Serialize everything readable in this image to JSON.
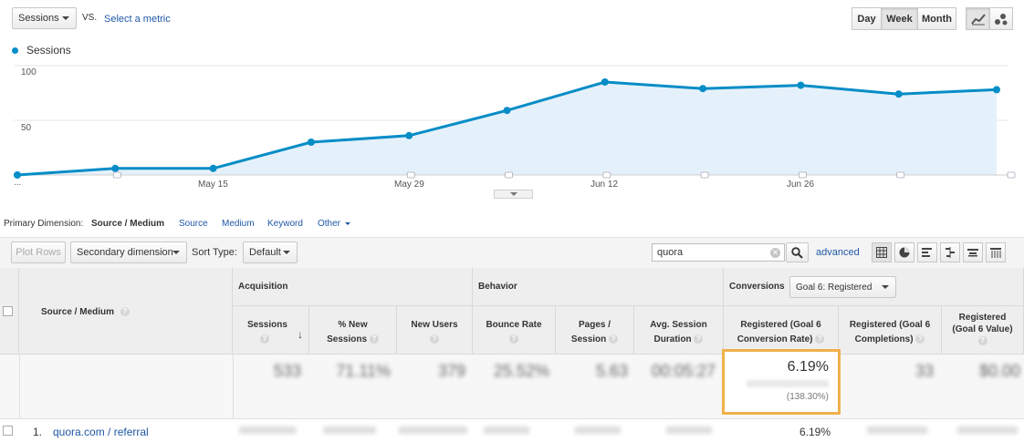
{
  "top": {
    "metric_select": "Sessions",
    "vs_label": "VS.",
    "select_metric_link": "Select a metric",
    "range_tabs": [
      "Day",
      "Week",
      "Month"
    ],
    "active_tab": "Week"
  },
  "chart_data": {
    "type": "area",
    "series": [
      {
        "name": "Sessions",
        "values": [
          0,
          6,
          6,
          30,
          36,
          59,
          85,
          79,
          82,
          74,
          78
        ]
      }
    ],
    "x_tick_labels": [
      "...",
      "May 15",
      "May 29",
      "Jun 12",
      "Jun 26"
    ],
    "y_tick_labels": [
      "100",
      "50"
    ],
    "ylim": [
      0,
      100
    ],
    "color": "#058dc7",
    "fill": "#e5f1fa",
    "grid": true
  },
  "dimension_bar": {
    "label": "Primary Dimension:",
    "active": "Source / Medium",
    "options": [
      "Source",
      "Medium",
      "Keyword",
      "Other"
    ]
  },
  "toolbar": {
    "plot_rows": "Plot Rows",
    "secondary_dimension": "Secondary dimension",
    "sort_type_label": "Sort Type:",
    "sort_default": "Default",
    "search_value": "quora",
    "advanced": "advanced"
  },
  "table": {
    "source_medium_header": "Source / Medium",
    "groups": {
      "acquisition": "Acquisition",
      "behavior": "Behavior",
      "conversions": "Conversions",
      "goal_select": "Goal 6: Registered"
    },
    "columns": {
      "sessions": "Sessions",
      "pct_new_1": "% New",
      "pct_new_2": "Sessions",
      "new_users": "New Users",
      "bounce_rate": "Bounce Rate",
      "pages_1": "Pages /",
      "pages_2": "Session",
      "avg_1": "Avg. Session",
      "avg_2": "Duration",
      "reg_rate_1": "Registered (Goal 6",
      "reg_rate_2": "Conversion Rate)",
      "reg_comp_1": "Registered (Goal 6",
      "reg_comp_2": "Completions)",
      "reg_val_1": "Registered",
      "reg_val_2": "(Goal 6 Value)"
    },
    "totals": {
      "sessions": "533",
      "pct_new": "71.11%",
      "new_users": "379",
      "bounce_rate": "25.52%",
      "pages": "5.63",
      "avg_duration": "00:05:27",
      "conversion_rate": "6.19%",
      "conversion_rate_sub": "(138.30%)",
      "completions": "33",
      "value": "$0.00"
    },
    "rows": [
      {
        "index": "1.",
        "source": "quora.com / referral",
        "conversion_rate": "6.19%"
      }
    ]
  },
  "colors": {
    "highlight": "#f0b04a",
    "link": "#1f58a6",
    "series": "#058dc7"
  }
}
